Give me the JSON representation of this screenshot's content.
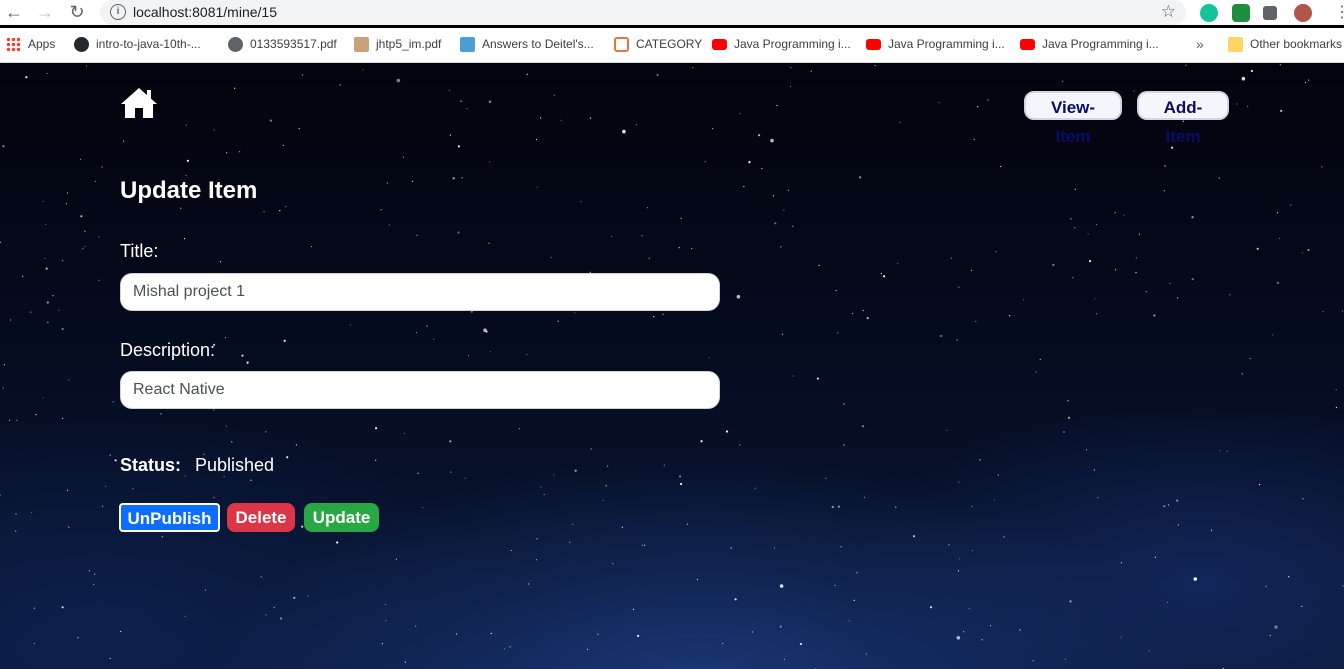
{
  "browser": {
    "url": "localhost:8081/mine/15",
    "bookmarks": [
      {
        "label": "Apps",
        "icon": "apps-grid-icon"
      },
      {
        "label": "intro-to-java-10th-...",
        "icon": "github-icon"
      },
      {
        "label": "0133593517.pdf",
        "icon": "globe-icon"
      },
      {
        "label": "jhtp5_im.pdf",
        "icon": "person-icon"
      },
      {
        "label": "Answers to Deitel's...",
        "icon": "chat-icon"
      },
      {
        "label": "CATEGORY",
        "icon": "category-icon"
      },
      {
        "label": "Java Programming i...",
        "icon": "youtube-icon"
      },
      {
        "label": "Java Programming i...",
        "icon": "youtube-icon"
      },
      {
        "label": "Java Programming i...",
        "icon": "youtube-icon"
      }
    ],
    "overflow": "»",
    "other_bookmarks": "Other bookmarks"
  },
  "nav": {
    "view_item": "View-Item",
    "add_item": "Add-Item"
  },
  "form": {
    "heading": "Update Item",
    "title_label": "Title:",
    "title_value": "Mishal project 1",
    "description_label": "Description:",
    "description_value": "React Native",
    "status_label": "Status:",
    "status_value": "Published"
  },
  "actions": {
    "unpublish": "UnPublish",
    "delete": "Delete",
    "update": "Update"
  },
  "colors": {
    "unpublish": "#0d6efd",
    "delete": "#dc3545",
    "update": "#28a745"
  }
}
